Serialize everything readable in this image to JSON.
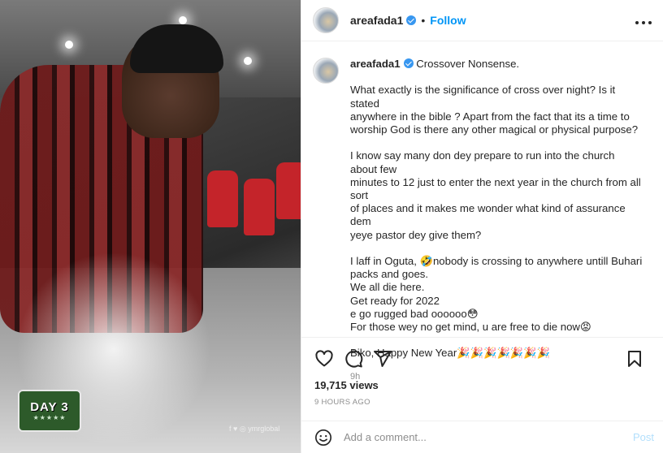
{
  "media": {
    "badge_text": "DAY 3",
    "badge_stars": "★★★★★",
    "watermark": "f ♥ ◎ ymrglobal"
  },
  "header": {
    "username": "areafada1",
    "separator": "•",
    "follow_label": "Follow",
    "more_label": "•••"
  },
  "caption": {
    "username": "areafada1",
    "lines": [
      "Crossover Nonsense.",
      "",
      "What exactly is the significance of cross over night? Is it stated",
      "anywhere in the bible ? Apart from the fact that its a time to",
      "worship God is there any other magical or physical purpose?",
      "",
      "I know say many don dey prepare to run into the church about few",
      "minutes to 12 just to enter the next year in the church from all sort",
      "of places and it makes me wonder what kind of assurance dem",
      "yeye pastor dey give them?",
      "",
      "I laff in Oguta, 🤣nobody is crossing to anywhere untill Buhari",
      "packs and goes.",
      "We all die here.",
      "Get ready for 2022",
      "e go rugged bad oooooo😳",
      "For those wey no get mind, u are free to die now😡",
      "",
      "Biko, Happy New Year🎉🎉🎉🎉🎉🎉🎉"
    ],
    "time": "9h"
  },
  "actions": {
    "views": "19,715 views",
    "ago": "9 HOURS AGO"
  },
  "comment": {
    "placeholder": "Add a comment...",
    "post_label": "Post"
  },
  "colors": {
    "accent": "#0095f6",
    "verified": "#3897f0",
    "post_disabled": "#b2dffc",
    "muted": "#8e8e8e"
  }
}
